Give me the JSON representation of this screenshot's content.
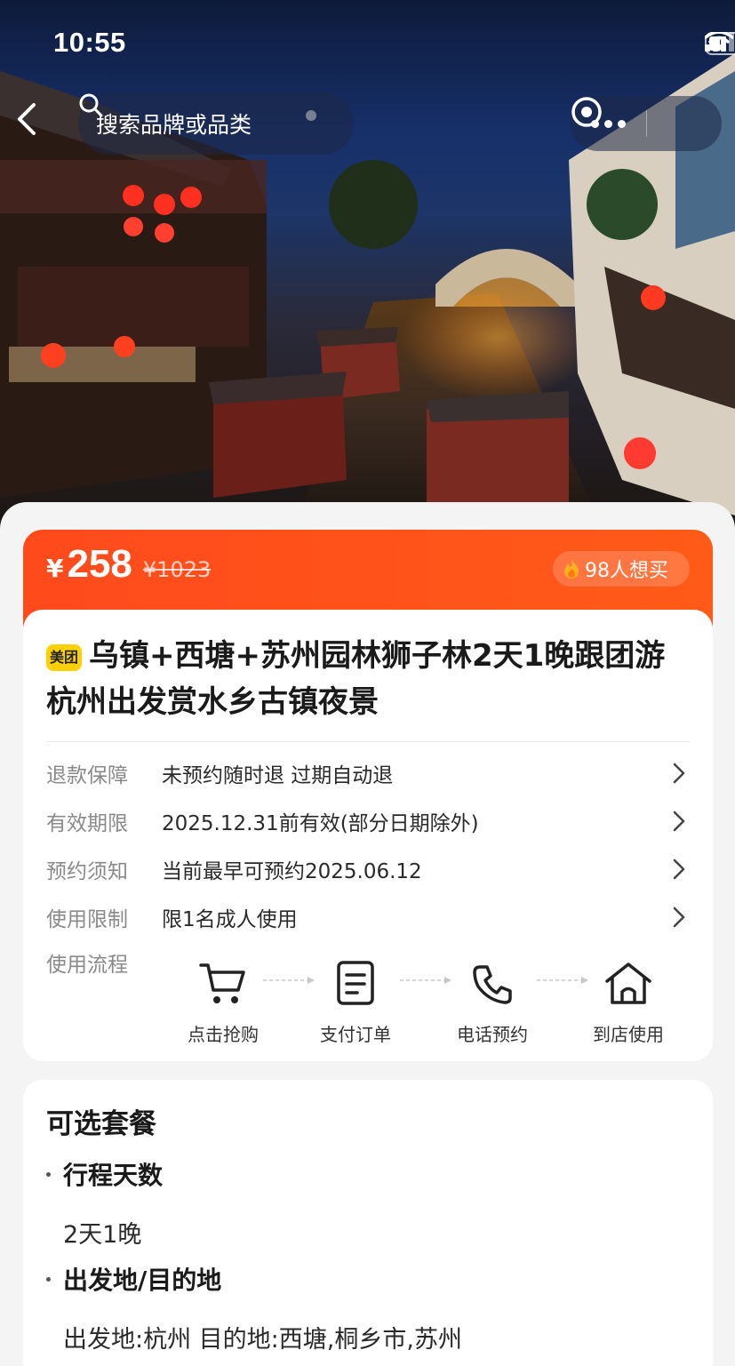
{
  "status_bar": {
    "time": "10:55"
  },
  "nav": {
    "search_placeholder": "搜索品牌或品类"
  },
  "price_bar": {
    "currency": "¥",
    "price": "258",
    "original_price": "¥1023",
    "want_count": "98人想买"
  },
  "product": {
    "badge": "美团",
    "title": "乌镇+西塘+苏州园林狮子林2天1晚跟团游 杭州出发赏水乡古镇夜景"
  },
  "info_rows": [
    {
      "label": "退款保障",
      "value": "未预约随时退 过期自动退"
    },
    {
      "label": "有效期限",
      "value": "2025.12.31前有效(部分日期除外)"
    },
    {
      "label": "预约须知",
      "value": "当前最早可预约2025.06.12"
    },
    {
      "label": "使用限制",
      "value": "限1名成人使用"
    }
  ],
  "flow": {
    "label": "使用流程",
    "steps": [
      {
        "label": "点击抢购",
        "icon": "cart-icon"
      },
      {
        "label": "支付订单",
        "icon": "document-icon"
      },
      {
        "label": "电话预约",
        "icon": "phone-icon"
      },
      {
        "label": "到店使用",
        "icon": "home-icon"
      }
    ]
  },
  "packages": {
    "title": "可选套餐",
    "sections": [
      {
        "heading": "行程天数",
        "value": "2天1晚"
      },
      {
        "heading": "出发地/目的地",
        "value": "出发地:杭州 目的地:西塘,桐乡市,苏州"
      }
    ]
  },
  "colors": {
    "accent": "#ff4a1c",
    "badge_yellow": "#ffd100",
    "hero_sky": "#17306a"
  }
}
